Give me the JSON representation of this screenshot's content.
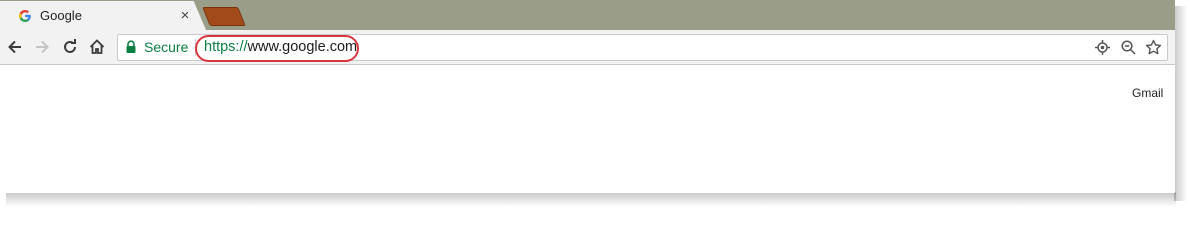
{
  "tab": {
    "title": "Google",
    "close_glyph": "×"
  },
  "toolbar": {
    "secure_label": "Secure",
    "url_scheme": "https://",
    "url_host": "www.google.com"
  },
  "page": {
    "gmail_link": "Gmail"
  },
  "colors": {
    "tabstrip": "#9a9e88",
    "secure_green": "#0b8043",
    "annotation_red": "#d9363e",
    "new_tab_brown": "#a34a1a"
  },
  "icons": {
    "favicon": "google-g-icon",
    "back": "arrow-left-icon",
    "forward": "arrow-right-icon",
    "reload": "reload-icon",
    "home": "home-icon",
    "lock": "lock-icon",
    "location": "location-target-icon",
    "zoom": "zoom-out-icon",
    "bookmark": "star-icon"
  }
}
